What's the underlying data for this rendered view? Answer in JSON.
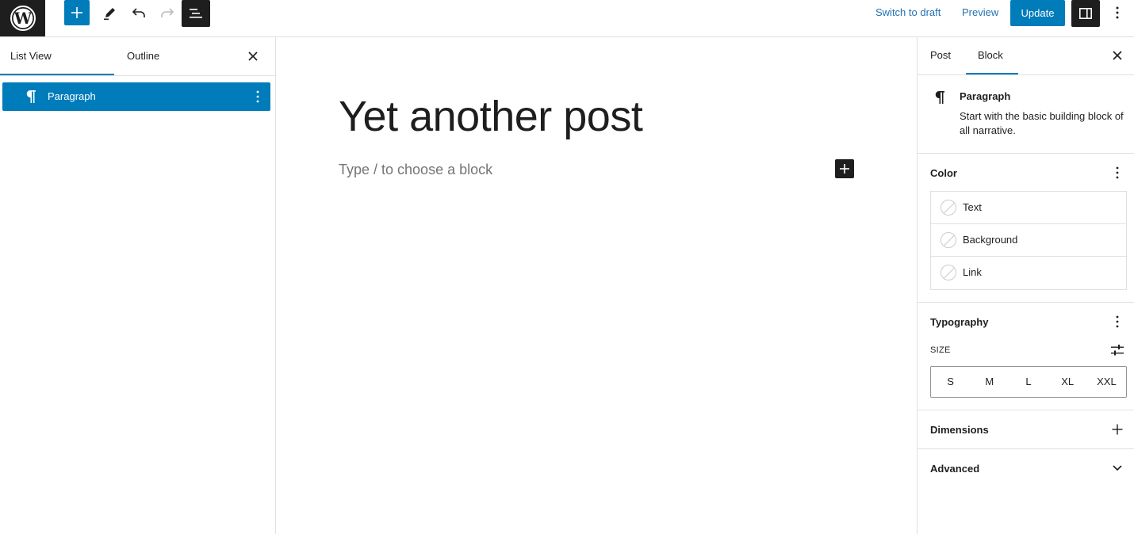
{
  "toolbar": {
    "switch_to_draft": "Switch to draft",
    "preview": "Preview",
    "update": "Update"
  },
  "left_panel": {
    "tabs": [
      "List View",
      "Outline"
    ],
    "active_tab": "List View",
    "items": [
      {
        "label": "Paragraph",
        "icon": "paragraph-icon",
        "selected": true
      }
    ]
  },
  "editor": {
    "title": "Yet another post",
    "placeholder": "Type / to choose a block"
  },
  "sidebar": {
    "tabs": [
      "Post",
      "Block"
    ],
    "active_tab": "Block",
    "block": {
      "name": "Paragraph",
      "description": "Start with the basic building block of all narrative."
    },
    "color": {
      "title": "Color",
      "items": [
        "Text",
        "Background",
        "Link"
      ]
    },
    "typography": {
      "title": "Typography",
      "size_label": "SIZE",
      "sizes": [
        "S",
        "M",
        "L",
        "XL",
        "XXL"
      ]
    },
    "dimensions": {
      "title": "Dimensions"
    },
    "advanced": {
      "title": "Advanced"
    }
  },
  "colors": {
    "accent": "#007cba",
    "dark": "#1e1e1e",
    "link": "#2271b1",
    "border": "#e0e0e0"
  }
}
